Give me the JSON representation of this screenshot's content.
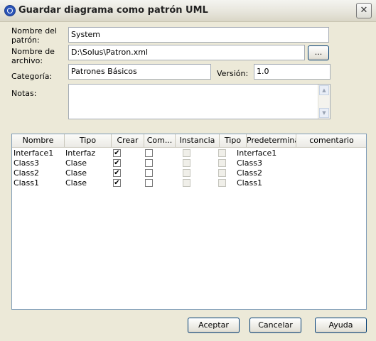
{
  "window": {
    "title": "Guardar diagrama como patrón UML",
    "close_symbol": "✕"
  },
  "form": {
    "pattern_name_label": "Nombre del patrón:",
    "pattern_name_value": "System",
    "file_name_label": "Nombre de archivo:",
    "file_name_value": "D:\\Solus\\Patron.xml",
    "browse_label": "...",
    "category_label": "Categoría:",
    "category_value": "Patrones Básicos",
    "version_label": "Versión:",
    "version_value": "1.0",
    "notes_label": "Notas:",
    "notes_value": ""
  },
  "table": {
    "columns": [
      "Nombre",
      "Tipo",
      "Crear",
      "Com...",
      "Instancia",
      "Tipo",
      "Predetermina...",
      "comentario"
    ],
    "rows": [
      {
        "nombre": "Interface1",
        "tipo": "Interfaz",
        "crear": true,
        "com": false,
        "instancia": false,
        "tipo2": false,
        "predeterminado": "Interface1",
        "comentario": ""
      },
      {
        "nombre": "Class3",
        "tipo": "Clase",
        "crear": true,
        "com": false,
        "instancia": false,
        "tipo2": false,
        "predeterminado": "Class3",
        "comentario": ""
      },
      {
        "nombre": "Class2",
        "tipo": "Clase",
        "crear": true,
        "com": false,
        "instancia": false,
        "tipo2": false,
        "predeterminado": "Class2",
        "comentario": ""
      },
      {
        "nombre": "Class1",
        "tipo": "Clase",
        "crear": true,
        "com": false,
        "instancia": false,
        "tipo2": false,
        "predeterminado": "Class1",
        "comentario": ""
      }
    ]
  },
  "buttons": {
    "accept": "Aceptar",
    "cancel": "Cancelar",
    "help": "Ayuda"
  },
  "icons": {
    "app": "uml-pattern-icon",
    "check": "✔"
  }
}
